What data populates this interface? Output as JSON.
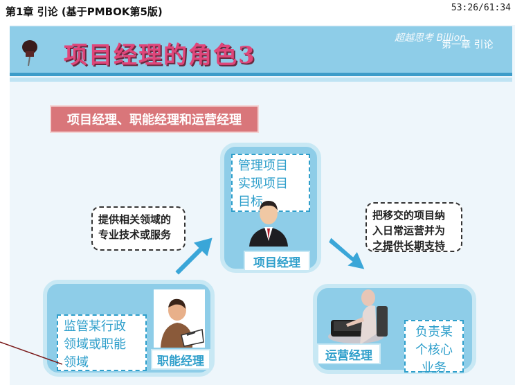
{
  "header": {
    "chapter_title": "第1章 引论 (基于PMBOK第5版)",
    "timer": "53:26/61:34"
  },
  "banner": {
    "title": "项目经理的角色3",
    "logo_text": "超越思考 Billion",
    "chapter_sub": "第一章 引论"
  },
  "subheading": "项目经理、职能经理和运营经理",
  "project_manager": {
    "duties": [
      "管理项目",
      "实现项目",
      "目标"
    ],
    "label": "项目经理"
  },
  "functional_manager": {
    "duties": [
      "监管某行政",
      "领域或职能",
      "领域"
    ],
    "label": "职能经理"
  },
  "operations_manager": {
    "duties": [
      "负责某",
      "个核心",
      "业务"
    ],
    "label": "运营经理"
  },
  "callouts": {
    "left": [
      "提供相关领域的",
      "专业技术或服务"
    ],
    "right": [
      "把移交的项目纳",
      "入日常运营并为",
      "之提供长期支持"
    ]
  },
  "colors": {
    "banner": "#8ecde8",
    "title": "#e0467a",
    "subheading_bg": "#d9767a",
    "accent_text": "#2f9fcb",
    "arrow": "#3aa6d8"
  },
  "icons": [
    "pushpin-icon",
    "businessman-icon",
    "writing-person-icon",
    "laptop-worker-icon",
    "arrow-up-right-icon",
    "arrow-down-right-icon"
  ]
}
